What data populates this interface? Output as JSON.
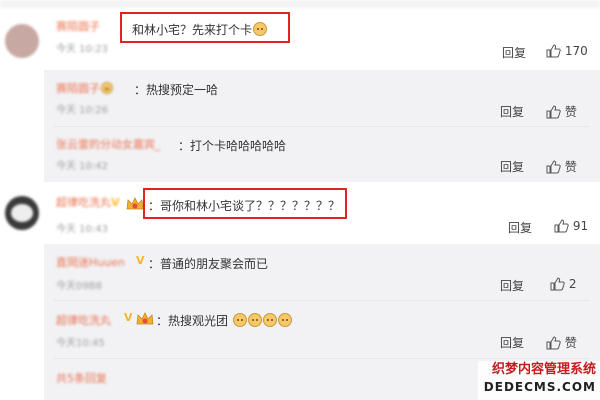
{
  "comments": [
    {
      "text": "和林小宅？先来打个卡",
      "reply": "回复",
      "likes": "170"
    },
    {
      "text": "：热搜预定一哈",
      "reply": "回复",
      "likes": "赞"
    },
    {
      "text": "：打个卡哈哈哈哈哈",
      "reply": "回复",
      "likes": "赞"
    },
    {
      "text": "：哥你和林小宅谈了？？？？？？？",
      "reply": "回复",
      "likes": "91"
    },
    {
      "text": "：普通的朋友聚会而已",
      "reply": "回复",
      "likes": "2"
    },
    {
      "text": "：热搜观光团",
      "reply": "回复",
      "likes": "赞"
    }
  ],
  "watermark": {
    "line1": "织梦内容管理系统",
    "line2": "DEDECMS.COM"
  },
  "colors": {
    "highlight": "#e3231f",
    "username": "#eb7350",
    "vip": "#f8b62d"
  }
}
